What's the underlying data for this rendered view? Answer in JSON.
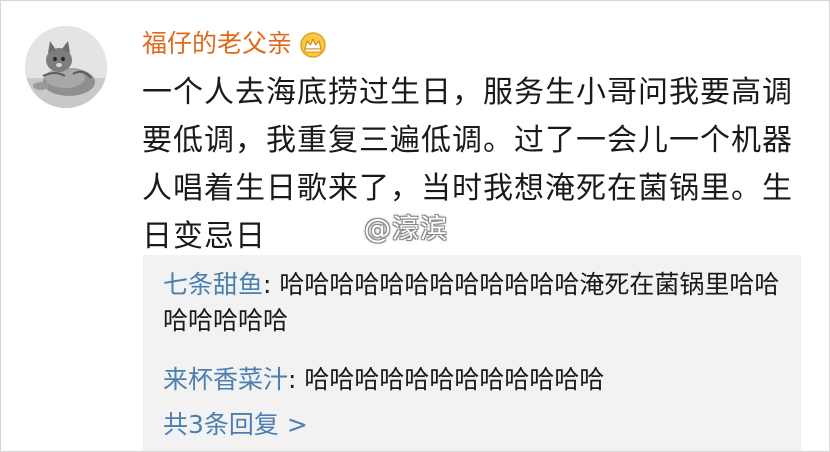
{
  "post": {
    "username": "福仔的老父亲",
    "badge_icon": "crown-vip-icon",
    "text": "一个人去海底捞过生日，服务生小哥问我要高调要低调，我重复三遍低调。过了一会儿一个机器人唱着生日歌来了，当时我想淹死在菌锅里。生日变忌日"
  },
  "watermark": "@濠滨",
  "replies": [
    {
      "user": "七条甜鱼",
      "separator": ": ",
      "text": "哈哈哈哈哈哈哈哈哈哈哈哈淹死在菌锅里哈哈哈哈哈哈哈"
    },
    {
      "user": "来杯香菜汁",
      "separator": ": ",
      "text": "哈哈哈哈哈哈哈哈哈哈哈哈"
    }
  ],
  "more_replies_label": "共3条回复 >",
  "colors": {
    "username": "#e06a1b",
    "reply_user": "#4a7fb0",
    "reply_bg": "#f2f2f2",
    "text": "#1a1a1a"
  }
}
